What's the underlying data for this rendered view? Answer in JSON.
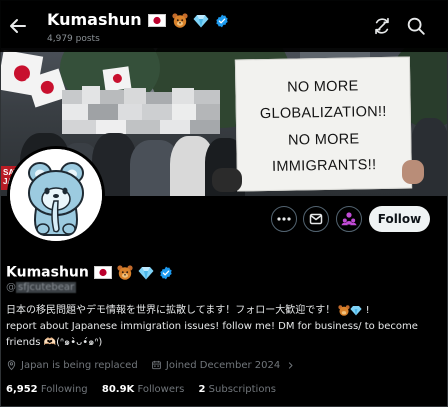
{
  "header": {
    "name": "Kumashun",
    "posts": "4,979 posts",
    "back_icon": "arrow-left-icon",
    "refresh_icon": "refresh-icon",
    "search_icon": "search-icon"
  },
  "banner": {
    "sign_lines": [
      "NO MORE",
      "GLOBALIZATION!!",
      "NO MORE",
      "IMMIGRANTS!!"
    ],
    "save_sign": "SAVE JAPAN"
  },
  "actions": {
    "more_icon": "more-icon",
    "message_icon": "envelope-icon",
    "grok_icon": "people-icon",
    "follow_label": "Follow"
  },
  "profile": {
    "name": "Kumashun",
    "handle_at": "@",
    "handle": "sfjcutebear",
    "bio_line1": "日本の移民問題やデモ情報を世界に拡散してます！フォロー大歓迎です！",
    "bio_line2": "report about Japanese immigration issues! follow me! DM for business/ to become",
    "bio_line3": "friends 🫶🏻(ᐢ๑•̀ᴗ•́๑ᐢ)",
    "location": "Japan is being replaced",
    "joined": "Joined December 2024"
  },
  "stats": {
    "following_count": "6,952",
    "following_label": "Following",
    "followers_count": "80.9K",
    "followers_label": "Followers",
    "subscriptions_count": "2",
    "subscriptions_label": "Subscriptions"
  },
  "colors": {
    "accent_verified": "#1d9bf0",
    "follow_bg": "#eff3f4",
    "secondary_text": "#71767b",
    "grok_purple": "#c14bd6"
  }
}
